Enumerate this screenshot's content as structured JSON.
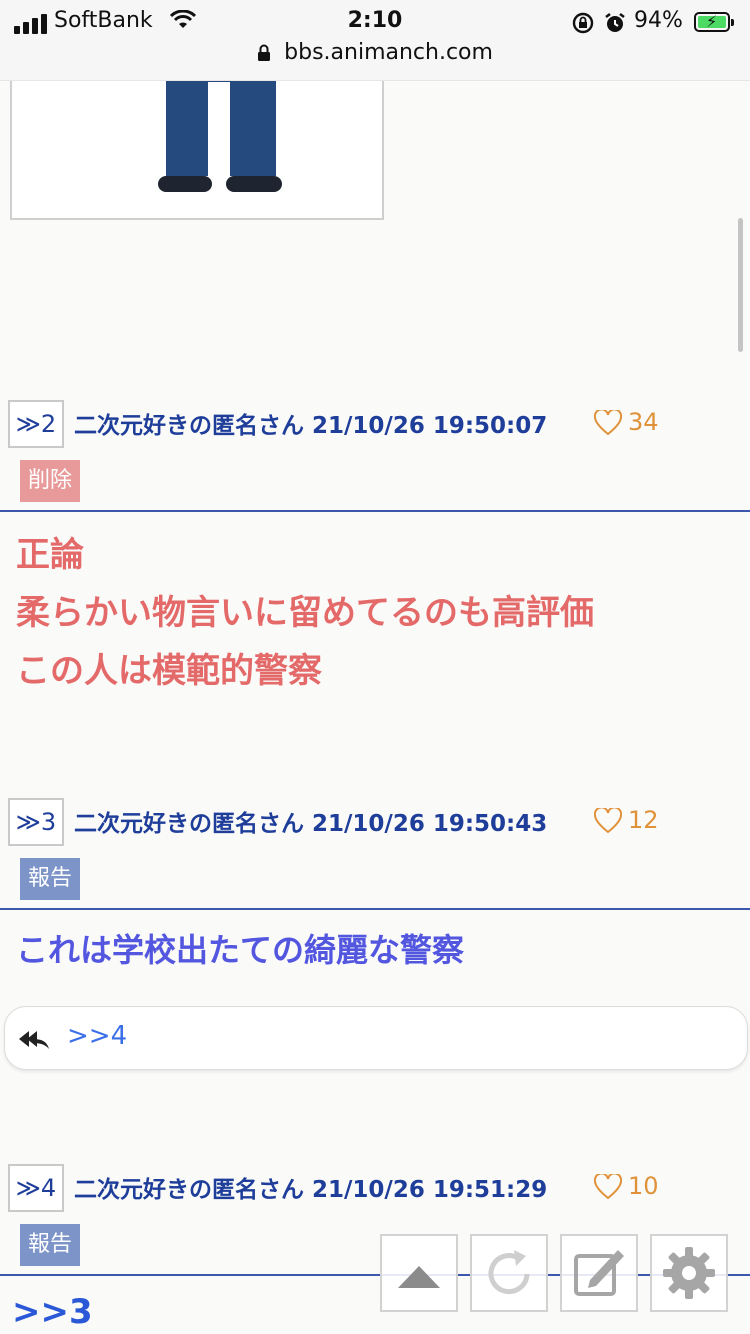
{
  "status_bar": {
    "carrier": "SoftBank",
    "time": "2:10",
    "battery": "94%",
    "url": "bbs.animanch.com"
  },
  "posts": [
    {
      "res_label": "≫2",
      "poster": "二次元好きの匿名さん",
      "datetime": "21/10/26 19:50:07",
      "likes": "34",
      "badge": "削除",
      "body_lines": [
        "正論",
        "柔らかい物言いに留めてるのも高評価",
        "この人は模範的警察"
      ]
    },
    {
      "res_label": "≫3",
      "poster": "二次元好きの匿名さん",
      "datetime": "21/10/26 19:50:43",
      "likes": "12",
      "badge": "報告",
      "body_lines": [
        "これは学校出たての綺麗な警察"
      ],
      "reply_link": ">>4"
    },
    {
      "res_label": "≫4",
      "poster": "二次元好きの匿名さん",
      "datetime": "21/10/26 19:51:29",
      "likes": "10",
      "badge": "報告",
      "body_lines": [
        ">>3"
      ]
    }
  ],
  "icons": {
    "like": "heart-icon",
    "reply": "reply-all-icon",
    "scroll_top": "triangle-up-icon",
    "reload": "reload-icon",
    "compose": "compose-icon",
    "settings": "gear-icon"
  },
  "colors": {
    "poster_blue": "#1e3e9a",
    "likes_orange": "#e0923a",
    "delete_badge": "#e89a9a",
    "report_badge": "#7d94c8",
    "red_text": "#e46a6a",
    "blue_text": "#5356df"
  }
}
